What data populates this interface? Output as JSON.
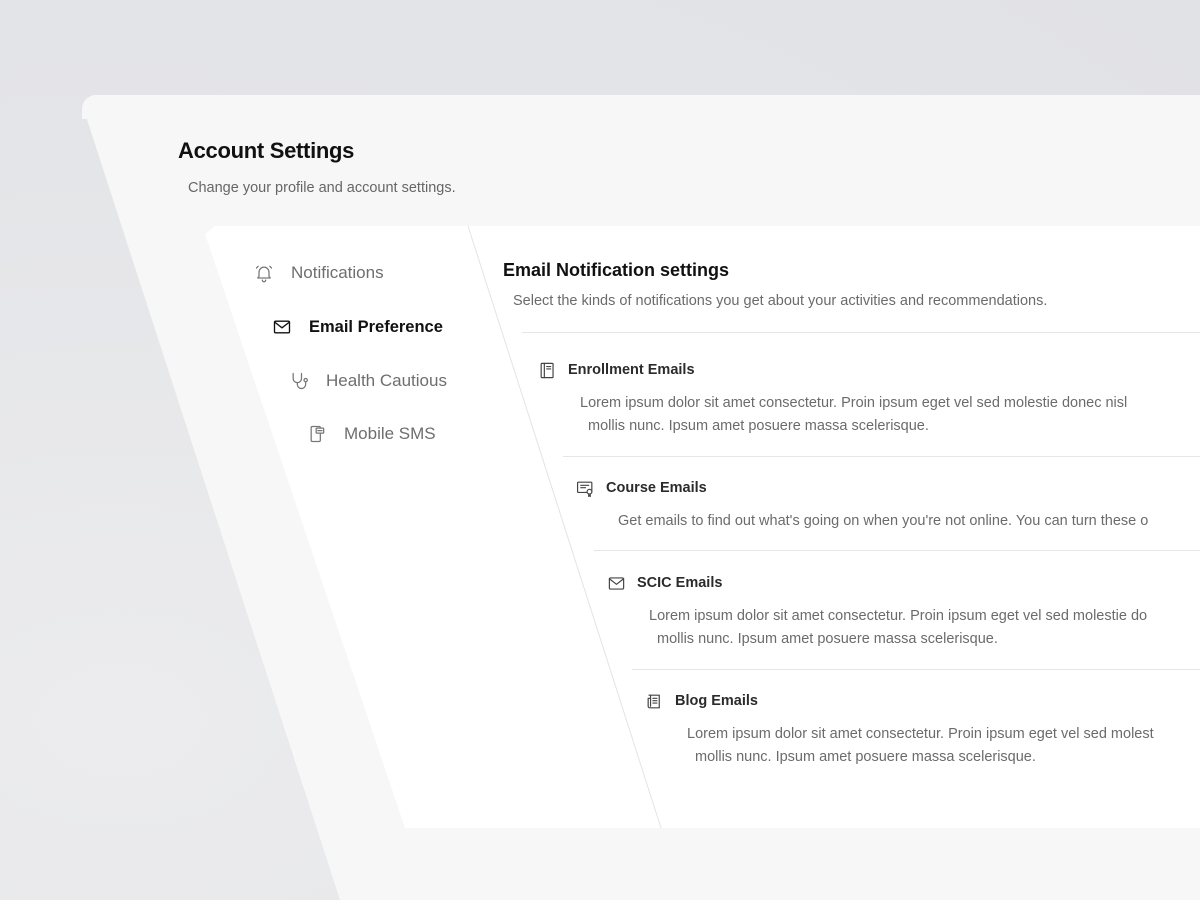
{
  "page": {
    "title": "Account Settings",
    "subtitle": "Change your profile and account settings."
  },
  "sidebar": {
    "items": [
      {
        "label": "Notifications",
        "icon": "bell-icon",
        "active": false
      },
      {
        "label": "Email Preference",
        "icon": "mail-icon",
        "active": true
      },
      {
        "label": "Health Cautious",
        "icon": "stethoscope-icon",
        "active": false
      },
      {
        "label": "Mobile SMS",
        "icon": "phone-icon",
        "active": false
      }
    ]
  },
  "content": {
    "title": "Email Notification settings",
    "subtitle": "Select the kinds of notifications you get about your activities and recommendations.",
    "sections": [
      {
        "title": "Enrollment Emails",
        "icon": "book-icon",
        "line1": "Lorem ipsum dolor sit amet consectetur. Proin ipsum eget vel sed molestie donec nisl",
        "line2": "mollis nunc. Ipsum amet posuere massa scelerisque."
      },
      {
        "title": "Course Emails",
        "icon": "certificate-icon",
        "line1": "Get emails to find out what's going on when you're not online. You can turn these o",
        "line2": ""
      },
      {
        "title": "SCIC Emails",
        "icon": "mail-icon",
        "line1": "Lorem ipsum dolor sit amet consectetur. Proin ipsum eget vel sed molestie do",
        "line2": "mollis nunc. Ipsum amet posuere massa scelerisque."
      },
      {
        "title": "Blog Emails",
        "icon": "newspaper-icon",
        "line1": "Lorem ipsum dolor sit amet consectetur. Proin ipsum eget vel sed molest",
        "line2": "mollis nunc. Ipsum amet posuere massa scelerisque."
      }
    ]
  },
  "colors": {
    "background": "#e5e6e9",
    "panel": "#f7f7f7",
    "card": "#ffffff",
    "text_primary": "#111111",
    "text_secondary": "#6b6b6b",
    "divider": "#e6e6e6"
  }
}
